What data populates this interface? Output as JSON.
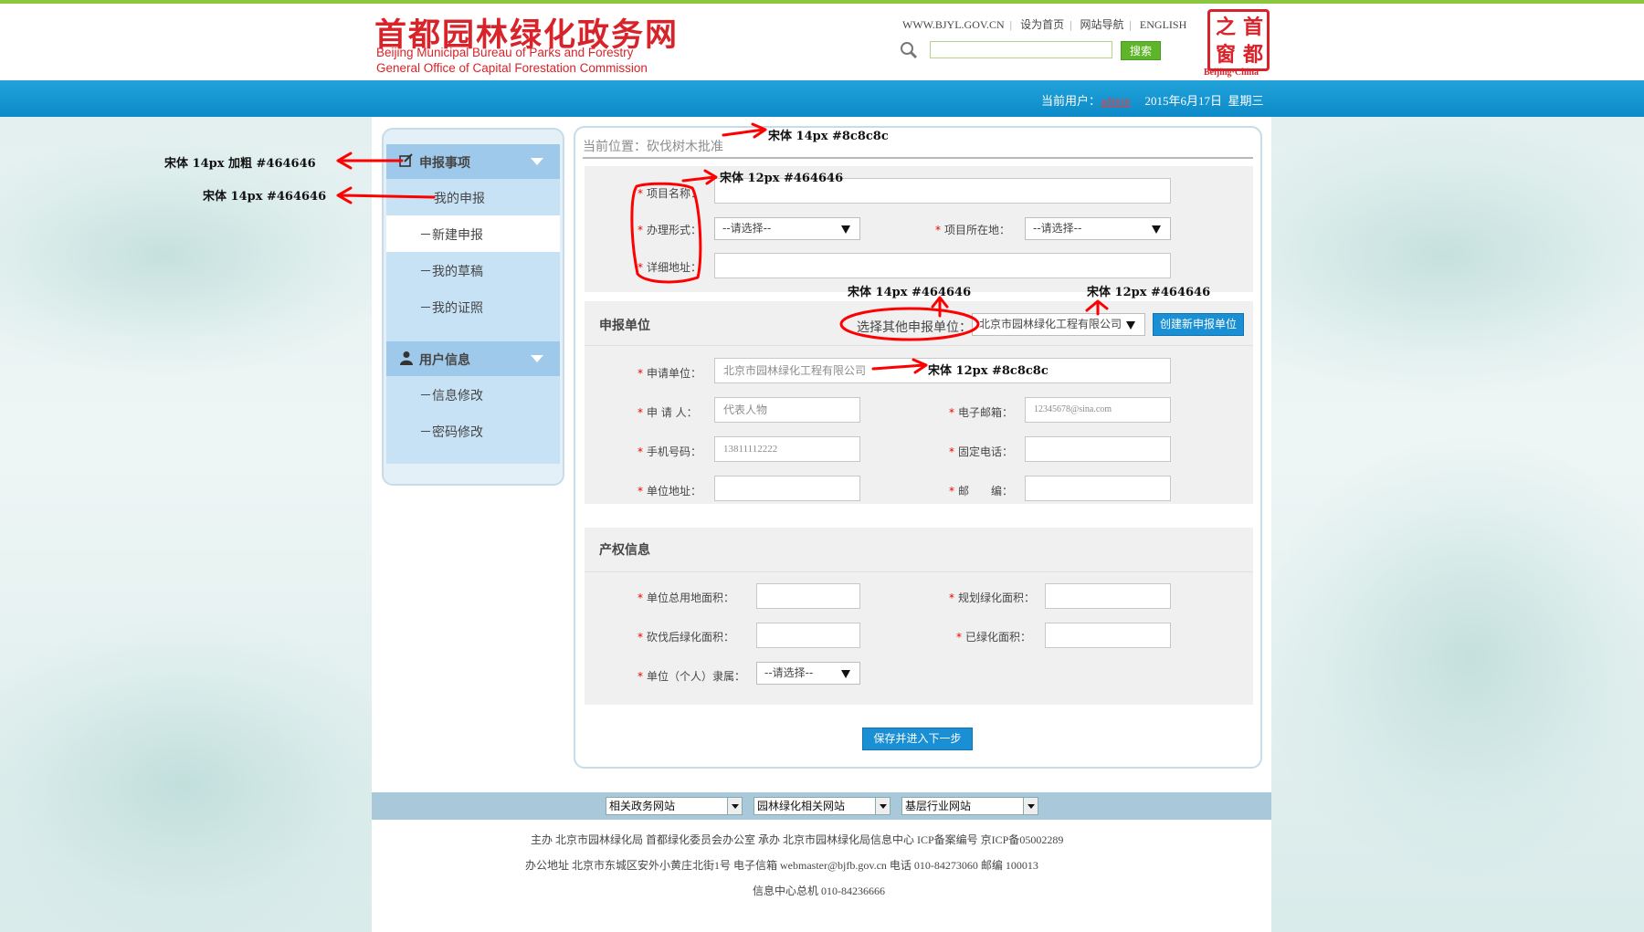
{
  "header": {
    "logo_cn": "首都园林绿化政务网",
    "logo_en1": "Beijing Municipal Bureau of Parks and Forestry",
    "logo_en2": "General Office of Capital Forestation Commission",
    "links": [
      "WWW.BJYL.GOV.CN",
      "设为首页",
      "网站导航",
      "ENGLISH"
    ],
    "search_button": "搜索",
    "search_value": "",
    "seal_chars": [
      "之",
      "首",
      "窗",
      "都"
    ],
    "seal_en": "Beijing·China"
  },
  "userbar": {
    "label": "当前用户：",
    "username": "admin",
    "date": "2015年6月17日",
    "weekday": "星期三"
  },
  "sidebar": {
    "group1": {
      "title": "申报事项",
      "items": [
        "我的申报",
        "－新建申报",
        "－我的草稿",
        "－我的证照"
      ]
    },
    "group2": {
      "title": "用户信息",
      "items": [
        "－信息修改",
        "－密码修改"
      ]
    }
  },
  "breadcrumb": "当前位置：砍伐树木批准",
  "project": {
    "name_label": "项目名称：",
    "name_value": "",
    "mode_label": "办理形式：",
    "mode_value": "--请选择--",
    "location_label": "项目所在地：",
    "location_value": "--请选择--",
    "address_label": "详细地址：",
    "address_value": ""
  },
  "applicant": {
    "title": "申报单位",
    "other_label": "选择其他申报单位：",
    "other_value": "北京市园林绿化工程有限公司",
    "create_button": "创建新申报单位",
    "unit_label": "申请单位：",
    "unit_value": "北京市园林绿化工程有限公司",
    "person_label": "申 请 人：",
    "person_value": "代表人物",
    "email_label": "电子邮箱：",
    "email_value": "12345678@sina.com",
    "mobile_label": "手机号码：",
    "mobile_value": "13811112222",
    "phone_label": "固定电话：",
    "phone_value": "",
    "addr_label": "单位地址：",
    "addr_value": "",
    "zip_label": "邮　　编：",
    "zip_value": ""
  },
  "property": {
    "title": "产权信息",
    "total_label": "单位总用地面积：",
    "total_value": "",
    "plan_label": "规划绿化面积：",
    "plan_value": "",
    "after_label": "砍伐后绿化面积：",
    "after_value": "",
    "done_label": "已绿化面积：",
    "done_value": "",
    "owner_label": "单位（个人）隶属：",
    "owner_value": "--请选择--"
  },
  "submit_button": "保存并进入下一步",
  "annotations": {
    "a1": "宋体 14px 加粗  #464646",
    "a2": "宋体 14px  #464646",
    "a3": "宋体 14px  #8c8c8c",
    "a4": "宋体 12px  #464646",
    "a5": "宋体 14px  #464646",
    "a6": "宋体 12px  #464646",
    "a7": "宋体 12px  #8c8c8c"
  },
  "footer": {
    "selects": [
      "相关政务网站",
      "园林绿化相关网站",
      "基层行业网站"
    ],
    "line1": "主办  北京市园林绿化局 首都绿化委员会办公室      承办  北京市园林绿化局信息中心      ICP备案编号 京ICP备05002289",
    "line2": "办公地址  北京市东城区安外小黄庄北街1号      电子信箱 webmaster@bjfb.gov.cn      电话 010-84273060      邮编 100013",
    "line3": "信息中心总机 010-84236666"
  },
  "colors": {
    "brand_red": "#d8232a",
    "blue_bar": "#1496d2",
    "sidebar_head": "#9ec9ea",
    "sidebar_item": "#c8e2f5",
    "text": "#464646",
    "muted": "#8c8c8c",
    "annotation_red": "#ff0000"
  }
}
